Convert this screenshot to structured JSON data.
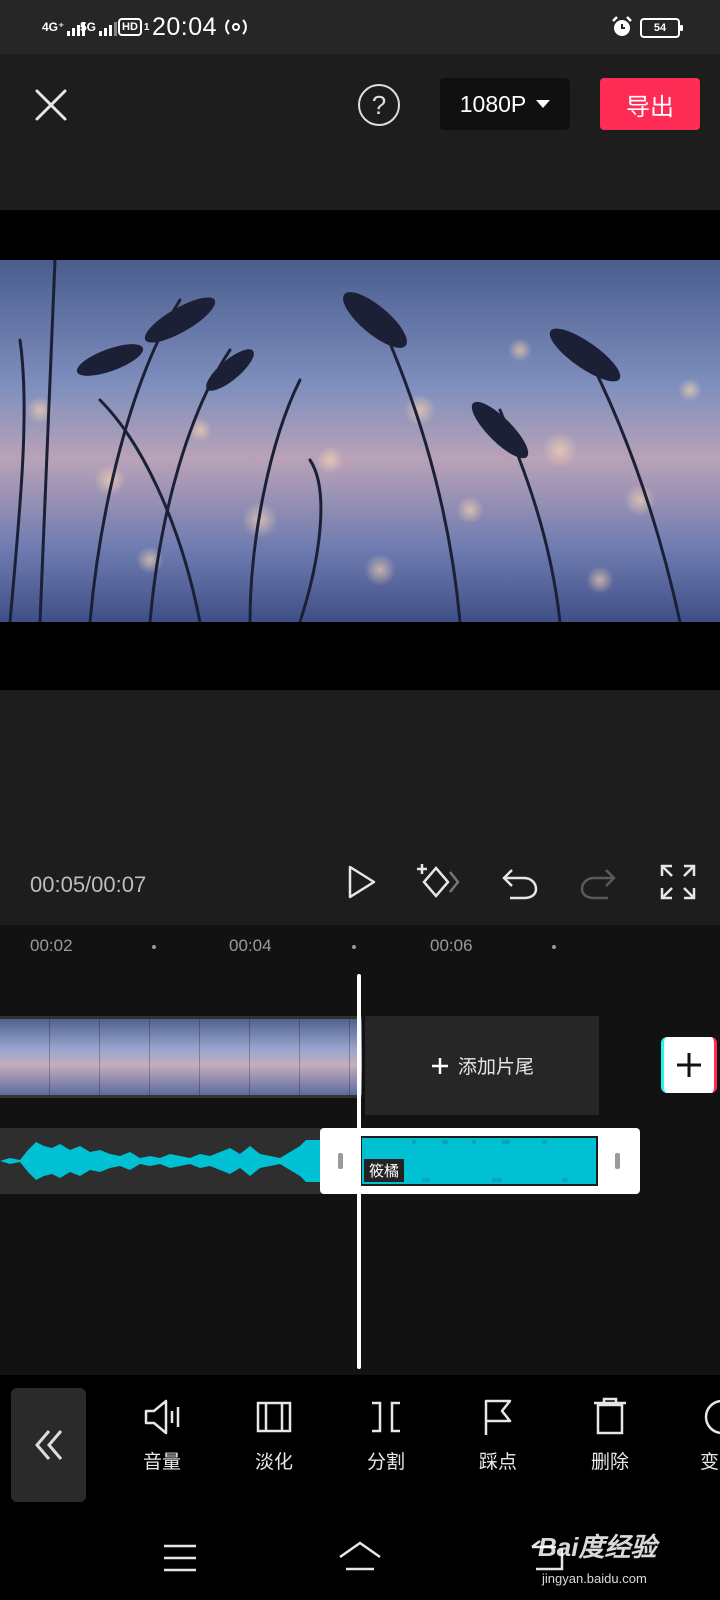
{
  "status_bar": {
    "network1": "4G⁺",
    "network2": "5G",
    "hd": "HD",
    "hd_sub": "1",
    "time": "20:04",
    "battery": "54"
  },
  "top_bar": {
    "resolution": "1080P",
    "export_label": "导出",
    "help_label": "?",
    "accent_color": "#fe2c55"
  },
  "player": {
    "timecode": "00:05/00:07"
  },
  "timeline": {
    "ruler": [
      "00:02",
      "00:04",
      "00:06"
    ],
    "add_ending_label": "添加片尾",
    "audio_clip_label": "筱橘",
    "audio_color": "#00c1d4"
  },
  "toolbar": {
    "tools": [
      {
        "label": "音量",
        "icon": "volume-icon"
      },
      {
        "label": "淡化",
        "icon": "fade-icon"
      },
      {
        "label": "分割",
        "icon": "split-icon"
      },
      {
        "label": "踩点",
        "icon": "beat-flag-icon"
      },
      {
        "label": "删除",
        "icon": "delete-icon"
      },
      {
        "label": "变",
        "icon": "speed-icon"
      }
    ]
  },
  "watermark": {
    "logo": "Bai度经验",
    "url": "jingyan.baidu.com"
  }
}
